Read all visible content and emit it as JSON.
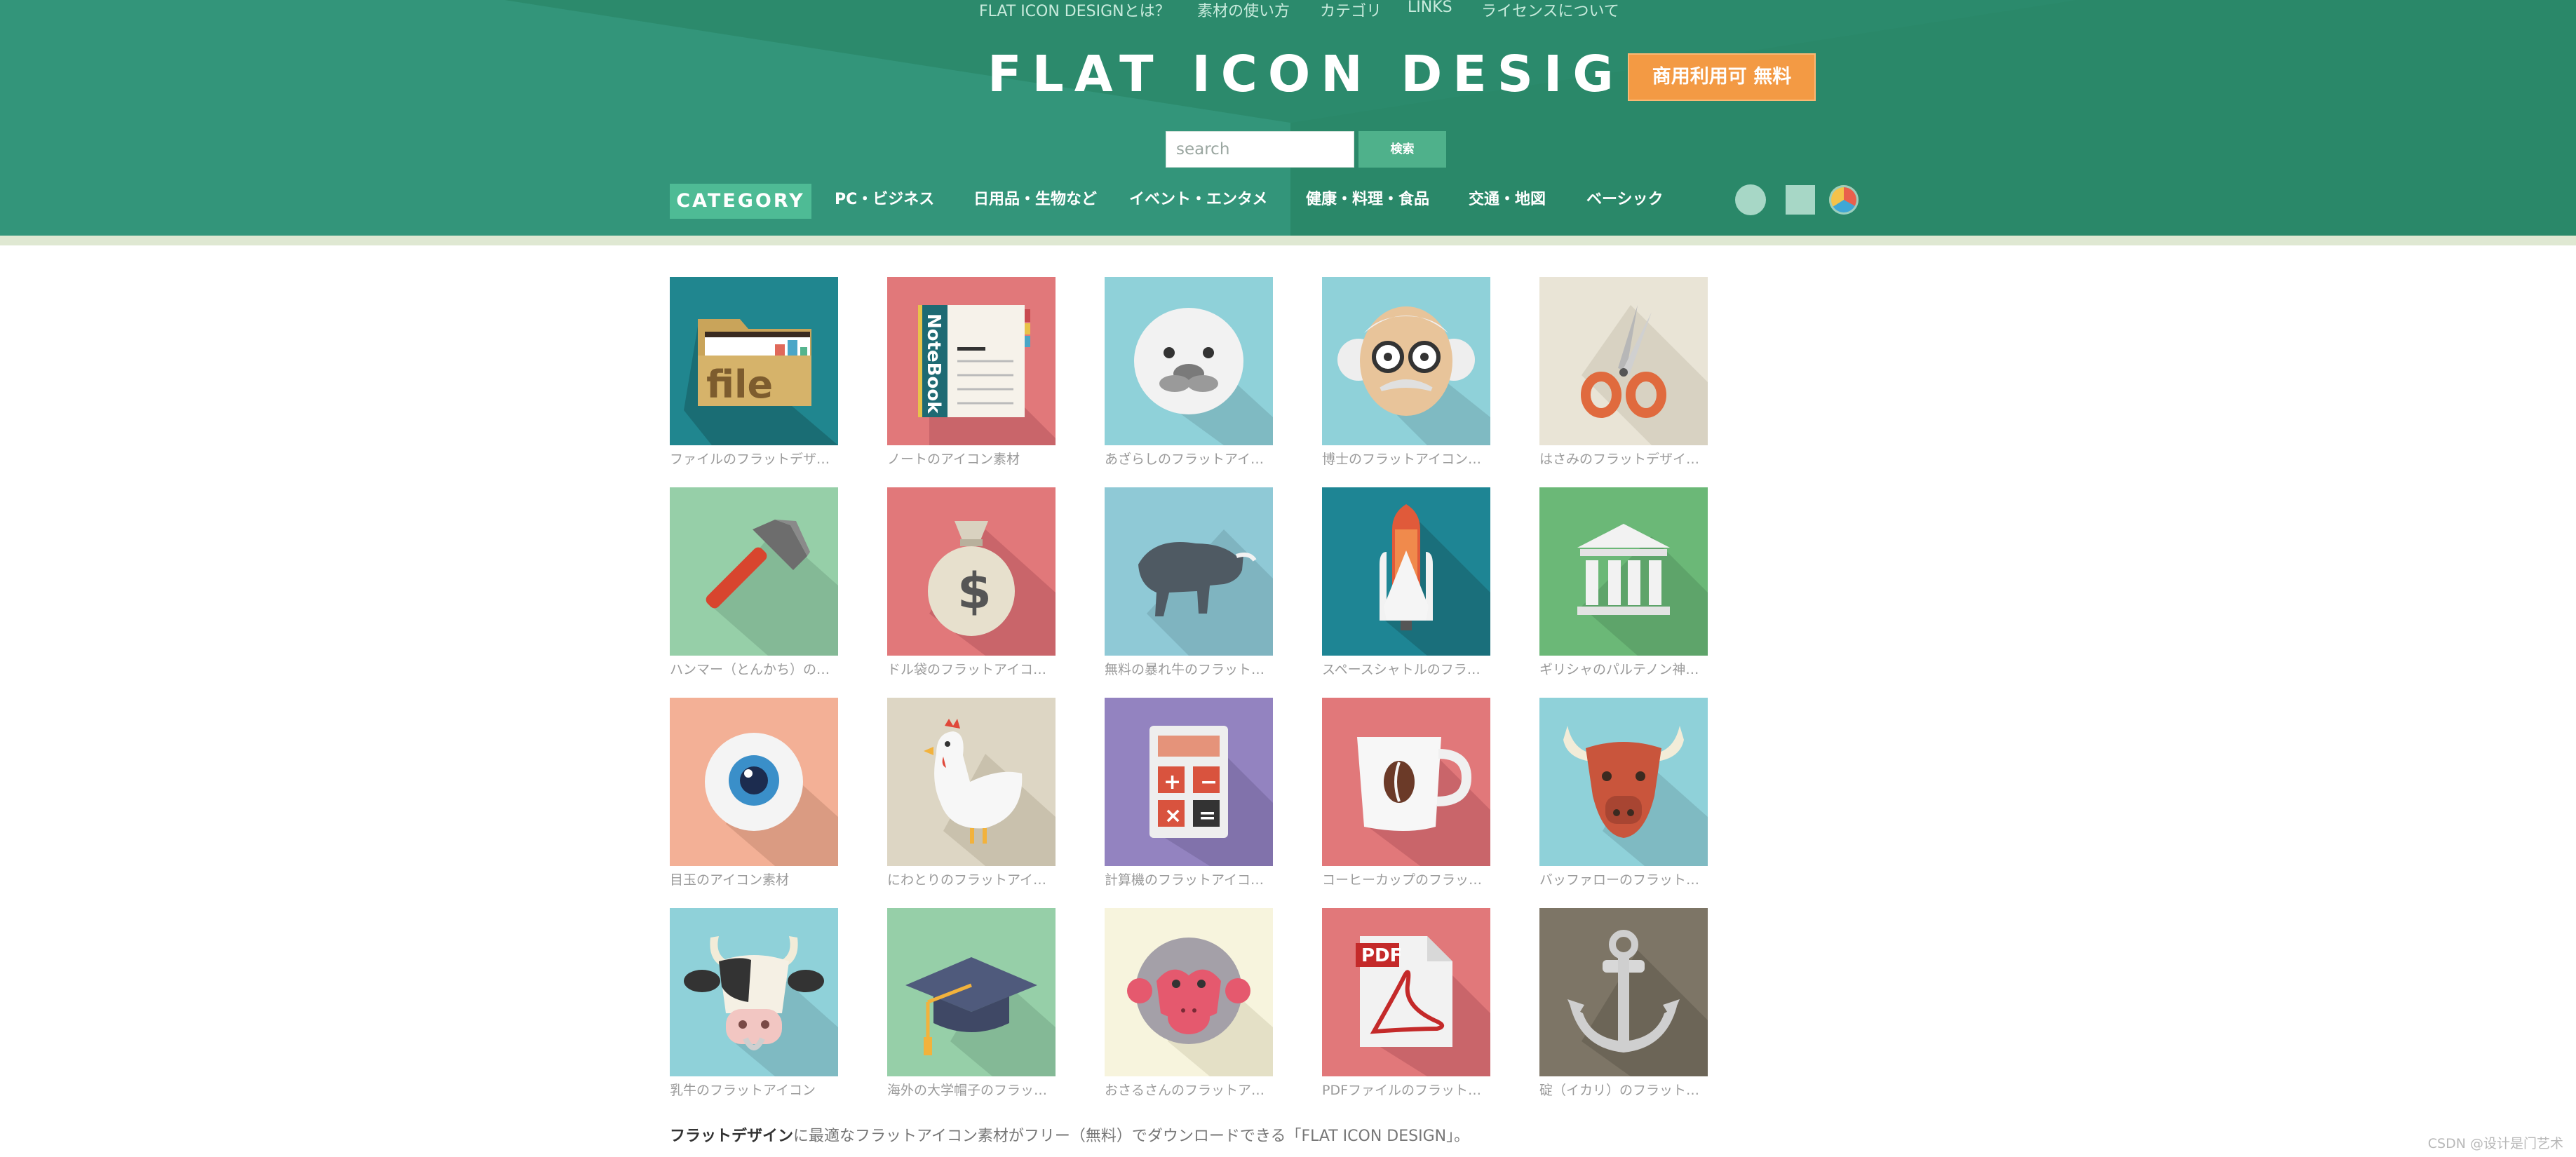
{
  "topnav": [
    "FLAT ICON DESIGNとは？",
    "素材の使い方",
    "カテゴリ",
    "LINKS",
    "ライセンスについて"
  ],
  "header": {
    "logo": "FLAT ICON DESIGN",
    "badge": "商用利用可 無料",
    "bg_color": "#2e9272"
  },
  "search": {
    "placeholder": "search",
    "button": "検索"
  },
  "category": {
    "label": "CATEGORY",
    "items": [
      "PC・ビジネス",
      "日用品・生物など",
      "イベント・エンタメ",
      "健康・料理・食品",
      "交通・地図",
      "ベーシック"
    ]
  },
  "view_options": [
    "circle-view-icon",
    "square-view-icon",
    "color-view-icon"
  ],
  "icons": [
    {
      "caption": "ファイルのフラットデザ…",
      "icon": "file-folder-icon",
      "bg": "#20868f"
    },
    {
      "caption": "ノートのアイコン素材",
      "icon": "notebook-icon",
      "bg": "#e1787a",
      "text": "NoteBook"
    },
    {
      "caption": "あざらしのフラットアイ…",
      "icon": "seal-icon",
      "bg": "#8fd1d9"
    },
    {
      "caption": "博士のフラットアイコン…",
      "icon": "professor-icon",
      "bg": "#8fd1d9"
    },
    {
      "caption": "はさみのフラットデザイ…",
      "icon": "scissors-icon",
      "bg": "#e9e4d6"
    },
    {
      "caption": "ハンマー（とんかち）の…",
      "icon": "hammer-icon",
      "bg": "#96cfa8"
    },
    {
      "caption": "ドル袋のフラットアイコ…",
      "icon": "money-bag-icon",
      "bg": "#e1787a"
    },
    {
      "caption": "無料の暴れ牛のフラット…",
      "icon": "bull-icon",
      "bg": "#8fc9d6"
    },
    {
      "caption": "スペースシャトルのフラ…",
      "icon": "space-shuttle-icon",
      "bg": "#1e8594"
    },
    {
      "caption": "ギリシャのパルテノン神…",
      "icon": "parthenon-icon",
      "bg": "#6bb877"
    },
    {
      "caption": "目玉のアイコン素材",
      "icon": "eyeball-icon",
      "bg": "#f3b096"
    },
    {
      "caption": "にわとりのフラットアイ…",
      "icon": "chicken-icon",
      "bg": "#ddd6c4"
    },
    {
      "caption": "計算機のフラットアイコ…",
      "icon": "calculator-icon",
      "bg": "#9383c0"
    },
    {
      "caption": "コーヒーカップのフラッ…",
      "icon": "coffee-cup-icon",
      "bg": "#e1787a"
    },
    {
      "caption": "バッファローのフラット…",
      "icon": "buffalo-icon",
      "bg": "#8fd1d9"
    },
    {
      "caption": "乳牛のフラットアイコン",
      "icon": "cow-icon",
      "bg": "#8fd1d9"
    },
    {
      "caption": "海外の大学帽子のフラッ…",
      "icon": "graduation-cap-icon",
      "bg": "#96cfa8"
    },
    {
      "caption": "おさるさんのフラットア…",
      "icon": "monkey-icon",
      "bg": "#f7f4dd"
    },
    {
      "caption": "PDFファイルのフラット…",
      "icon": "pdf-file-icon",
      "bg": "#e1787a",
      "text": "PDF"
    },
    {
      "caption": "碇（イカリ）のフラット…",
      "icon": "anchor-icon",
      "bg": "#7d7566"
    }
  ],
  "footer": {
    "bold": "フラットデザイン",
    "text": "に最適なフラットアイコン素材がフリー（無料）でダウンロードできる「FLAT ICON DESIGN」。"
  },
  "watermark": "CSDN @设计是门艺术"
}
